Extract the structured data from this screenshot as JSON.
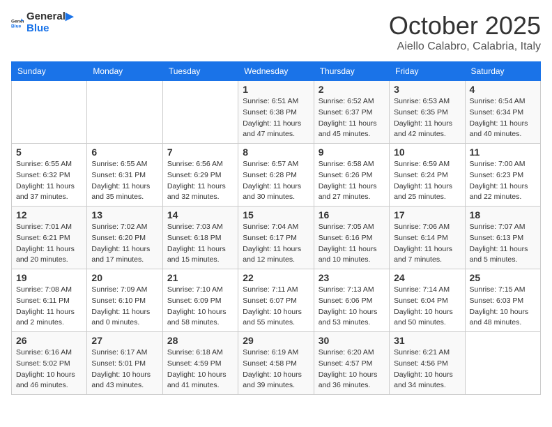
{
  "logo": {
    "text_general": "General",
    "text_blue": "Blue"
  },
  "title": "October 2025",
  "location": "Aiello Calabro, Calabria, Italy",
  "headers": [
    "Sunday",
    "Monday",
    "Tuesday",
    "Wednesday",
    "Thursday",
    "Friday",
    "Saturday"
  ],
  "weeks": [
    [
      {
        "day": "",
        "info": ""
      },
      {
        "day": "",
        "info": ""
      },
      {
        "day": "",
        "info": ""
      },
      {
        "day": "1",
        "info": "Sunrise: 6:51 AM\nSunset: 6:38 PM\nDaylight: 11 hours\nand 47 minutes."
      },
      {
        "day": "2",
        "info": "Sunrise: 6:52 AM\nSunset: 6:37 PM\nDaylight: 11 hours\nand 45 minutes."
      },
      {
        "day": "3",
        "info": "Sunrise: 6:53 AM\nSunset: 6:35 PM\nDaylight: 11 hours\nand 42 minutes."
      },
      {
        "day": "4",
        "info": "Sunrise: 6:54 AM\nSunset: 6:34 PM\nDaylight: 11 hours\nand 40 minutes."
      }
    ],
    [
      {
        "day": "5",
        "info": "Sunrise: 6:55 AM\nSunset: 6:32 PM\nDaylight: 11 hours\nand 37 minutes."
      },
      {
        "day": "6",
        "info": "Sunrise: 6:55 AM\nSunset: 6:31 PM\nDaylight: 11 hours\nand 35 minutes."
      },
      {
        "day": "7",
        "info": "Sunrise: 6:56 AM\nSunset: 6:29 PM\nDaylight: 11 hours\nand 32 minutes."
      },
      {
        "day": "8",
        "info": "Sunrise: 6:57 AM\nSunset: 6:28 PM\nDaylight: 11 hours\nand 30 minutes."
      },
      {
        "day": "9",
        "info": "Sunrise: 6:58 AM\nSunset: 6:26 PM\nDaylight: 11 hours\nand 27 minutes."
      },
      {
        "day": "10",
        "info": "Sunrise: 6:59 AM\nSunset: 6:24 PM\nDaylight: 11 hours\nand 25 minutes."
      },
      {
        "day": "11",
        "info": "Sunrise: 7:00 AM\nSunset: 6:23 PM\nDaylight: 11 hours\nand 22 minutes."
      }
    ],
    [
      {
        "day": "12",
        "info": "Sunrise: 7:01 AM\nSunset: 6:21 PM\nDaylight: 11 hours\nand 20 minutes."
      },
      {
        "day": "13",
        "info": "Sunrise: 7:02 AM\nSunset: 6:20 PM\nDaylight: 11 hours\nand 17 minutes."
      },
      {
        "day": "14",
        "info": "Sunrise: 7:03 AM\nSunset: 6:18 PM\nDaylight: 11 hours\nand 15 minutes."
      },
      {
        "day": "15",
        "info": "Sunrise: 7:04 AM\nSunset: 6:17 PM\nDaylight: 11 hours\nand 12 minutes."
      },
      {
        "day": "16",
        "info": "Sunrise: 7:05 AM\nSunset: 6:16 PM\nDaylight: 11 hours\nand 10 minutes."
      },
      {
        "day": "17",
        "info": "Sunrise: 7:06 AM\nSunset: 6:14 PM\nDaylight: 11 hours\nand 7 minutes."
      },
      {
        "day": "18",
        "info": "Sunrise: 7:07 AM\nSunset: 6:13 PM\nDaylight: 11 hours\nand 5 minutes."
      }
    ],
    [
      {
        "day": "19",
        "info": "Sunrise: 7:08 AM\nSunset: 6:11 PM\nDaylight: 11 hours\nand 2 minutes."
      },
      {
        "day": "20",
        "info": "Sunrise: 7:09 AM\nSunset: 6:10 PM\nDaylight: 11 hours\nand 0 minutes."
      },
      {
        "day": "21",
        "info": "Sunrise: 7:10 AM\nSunset: 6:09 PM\nDaylight: 10 hours\nand 58 minutes."
      },
      {
        "day": "22",
        "info": "Sunrise: 7:11 AM\nSunset: 6:07 PM\nDaylight: 10 hours\nand 55 minutes."
      },
      {
        "day": "23",
        "info": "Sunrise: 7:13 AM\nSunset: 6:06 PM\nDaylight: 10 hours\nand 53 minutes."
      },
      {
        "day": "24",
        "info": "Sunrise: 7:14 AM\nSunset: 6:04 PM\nDaylight: 10 hours\nand 50 minutes."
      },
      {
        "day": "25",
        "info": "Sunrise: 7:15 AM\nSunset: 6:03 PM\nDaylight: 10 hours\nand 48 minutes."
      }
    ],
    [
      {
        "day": "26",
        "info": "Sunrise: 6:16 AM\nSunset: 5:02 PM\nDaylight: 10 hours\nand 46 minutes."
      },
      {
        "day": "27",
        "info": "Sunrise: 6:17 AM\nSunset: 5:01 PM\nDaylight: 10 hours\nand 43 minutes."
      },
      {
        "day": "28",
        "info": "Sunrise: 6:18 AM\nSunset: 4:59 PM\nDaylight: 10 hours\nand 41 minutes."
      },
      {
        "day": "29",
        "info": "Sunrise: 6:19 AM\nSunset: 4:58 PM\nDaylight: 10 hours\nand 39 minutes."
      },
      {
        "day": "30",
        "info": "Sunrise: 6:20 AM\nSunset: 4:57 PM\nDaylight: 10 hours\nand 36 minutes."
      },
      {
        "day": "31",
        "info": "Sunrise: 6:21 AM\nSunset: 4:56 PM\nDaylight: 10 hours\nand 34 minutes."
      },
      {
        "day": "",
        "info": ""
      }
    ]
  ]
}
